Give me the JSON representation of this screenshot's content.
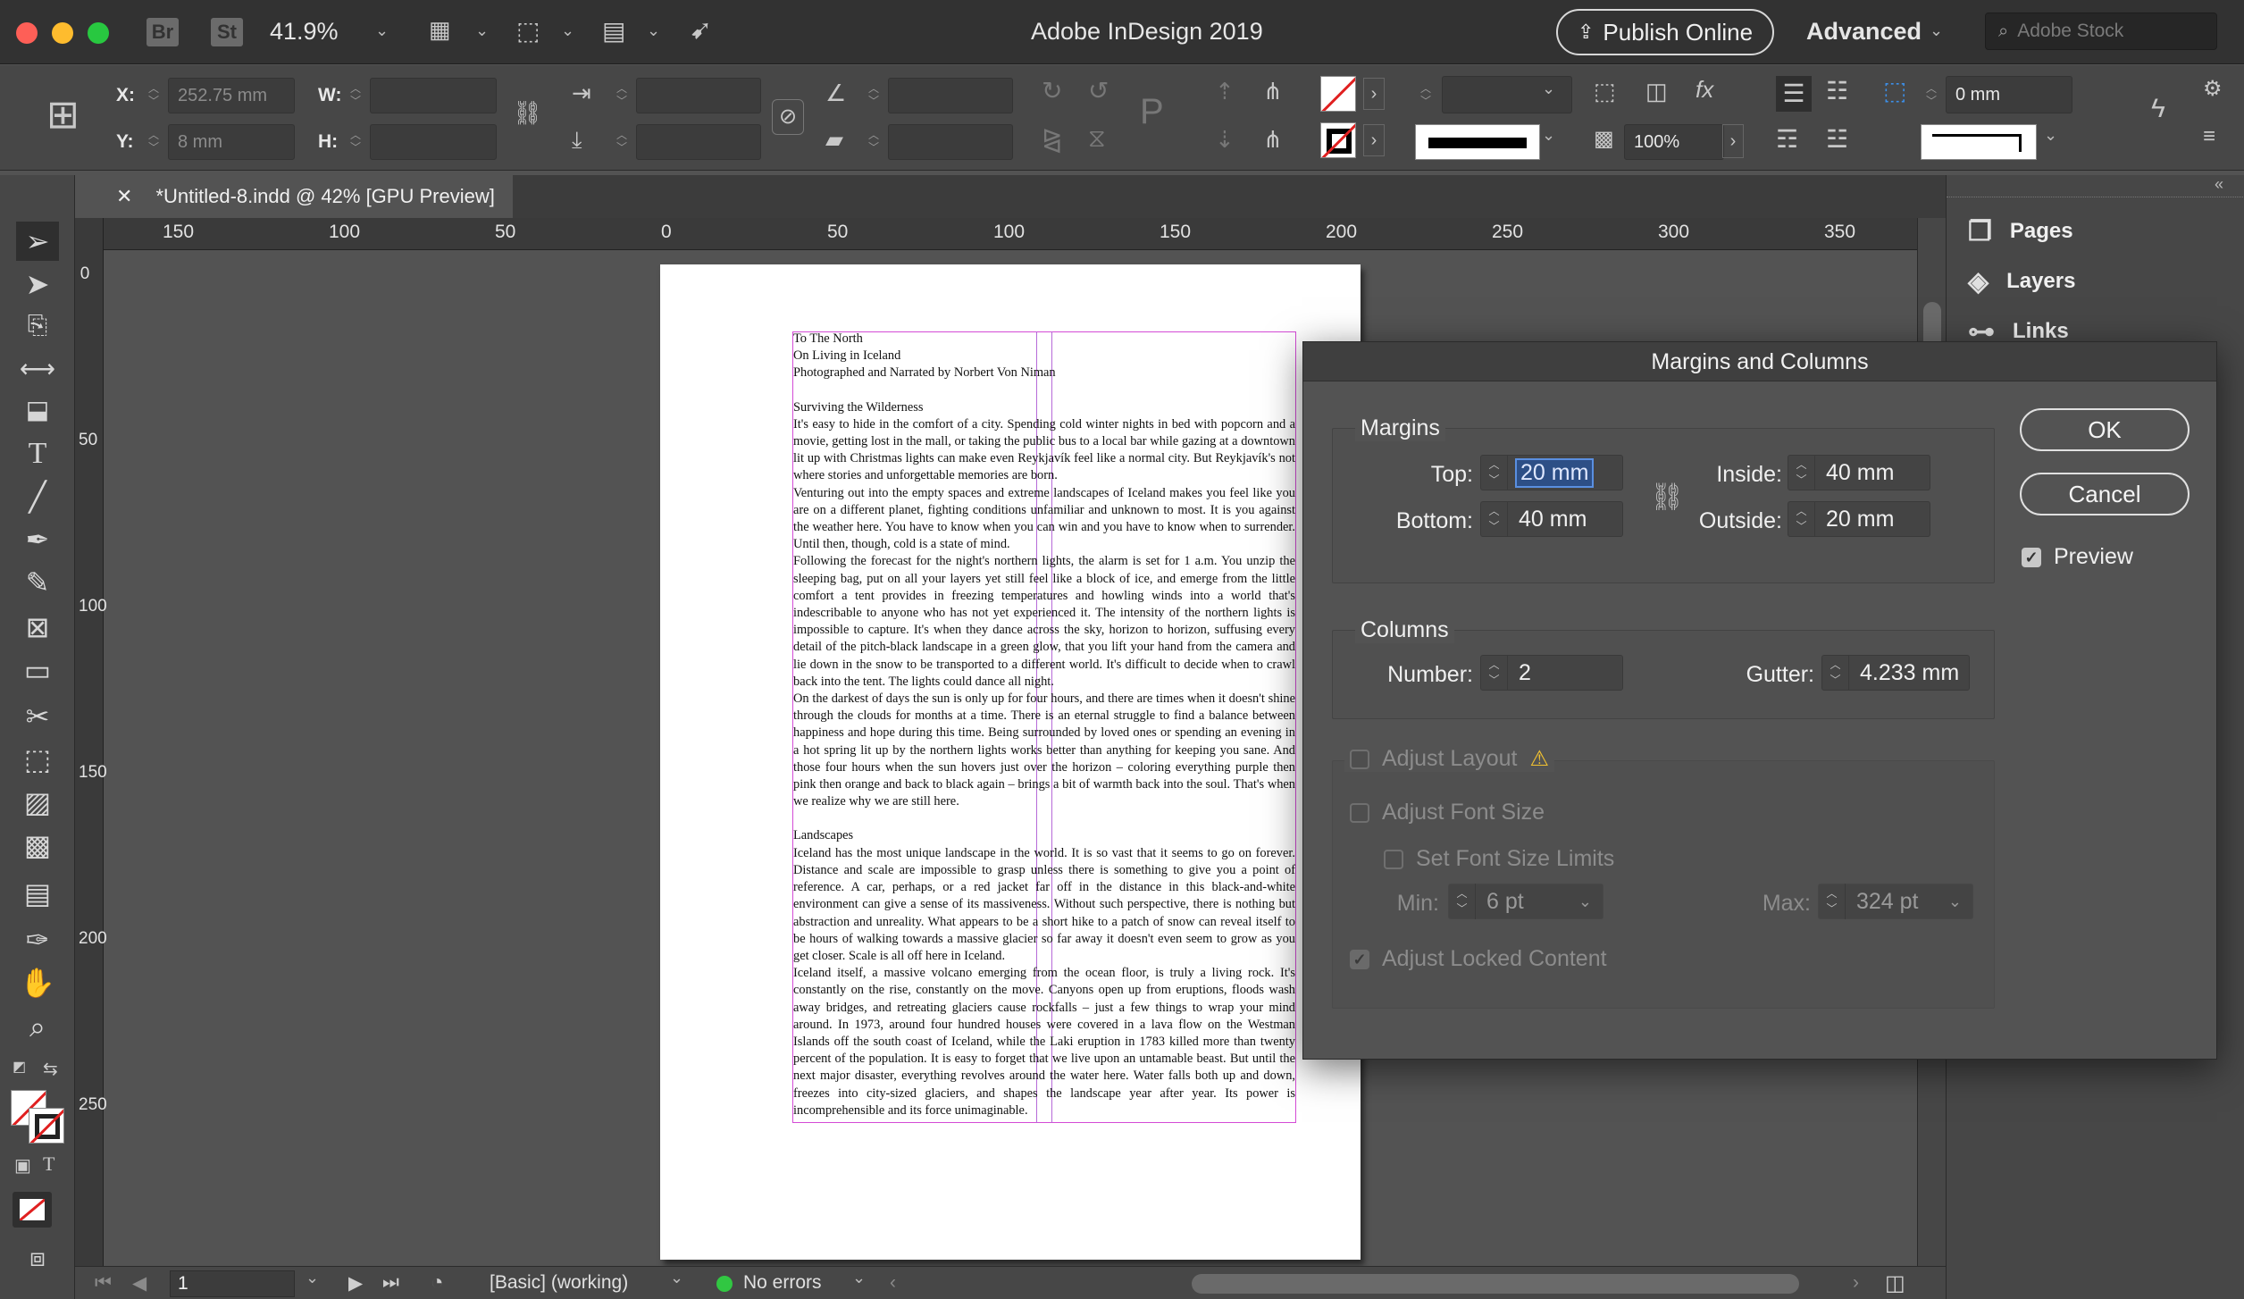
{
  "app": {
    "title": "Adobe InDesign 2019",
    "zoom": "41.9%",
    "bridge_badge": "Br",
    "stock_badge": "St",
    "publish_online": "Publish Online",
    "workspace": "Advanced",
    "search_placeholder": "Adobe Stock"
  },
  "control": {
    "x_label": "X:",
    "x_value": "252.75 mm",
    "y_label": "Y:",
    "y_value": "8 mm",
    "w_label": "W:",
    "w_value": "",
    "h_label": "H:",
    "h_value": "",
    "opacity_value": "100%",
    "offset_value": "0 mm"
  },
  "document_tab": {
    "title": "*Untitled-8.indd @ 42% [GPU Preview]"
  },
  "ruler": {
    "h_ticks": [
      "150",
      "100",
      "50",
      "0",
      "50",
      "100",
      "150",
      "200",
      "250",
      "300",
      "350"
    ],
    "v_ticks": [
      "0",
      "50",
      "100",
      "150",
      "200",
      "250"
    ]
  },
  "document": {
    "paragraphs": [
      "To The North",
      "On Living in Iceland",
      "Photographed and Narrated by Norbert Von Niman",
      "",
      "Surviving the Wilderness",
      "It's easy to hide in the comfort of a city. Spending cold winter nights in bed with popcorn and a movie, getting lost in the mall, or taking the public bus to a local bar while gazing at a downtown lit up with Christmas lights can make even Reykjavík feel like a normal city. But Reykjavík's not where stories and unforgettable memories are born.",
      "Venturing out into the empty spaces and extreme landscapes of Iceland makes you feel like you are on a different planet, fighting conditions unfamiliar and unknown to most. It is you against the weather here. You have to know when you can win and you have to know when to surrender. Until then, though, cold is a state of mind.",
      "Following the forecast for the night's northern lights, the alarm is set for 1 a.m. You unzip the sleeping bag, put on all your layers yet still feel like a block of ice, and emerge from the little comfort a tent provides in freezing temperatures and howling winds into a world that's indescribable to anyone who has not yet experienced it. The intensity of the northern lights is impossible to capture. It's when they dance across the sky, horizon to horizon, suffusing every detail of the pitch-black landscape in a green glow, that you lift your hand from the camera and lie down in the snow to be transported to a different world. It's difficult to decide when to crawl back into the tent. The lights could dance all night.",
      "On the darkest of days the sun is only up for four hours, and there are times when it doesn't shine through the clouds for months at a time. There is an eternal struggle to find a balance between happiness and hope during this time. Being surrounded by loved ones or spending an evening in a hot spring lit up by the northern lights works better than anything for keeping you sane. And those four hours when the sun hovers just over the horizon – coloring everything purple then pink then orange and back to black again – brings a bit of warmth back into the soul. That's when we realize why we are still here.",
      "",
      "Landscapes",
      "Iceland has the most unique landscape in the world. It is so vast that it seems to go on forever. Distance and scale are impossible to grasp unless there is something to give you a point of reference. A car, perhaps, or a red jacket far off in the distance in this black-and-white environment can give a sense of its massiveness. Without such perspective, there is nothing but abstraction and unreality. What appears to be a short hike to a patch of snow can reveal itself to be hours of walking towards a massive glacier so far away it doesn't even seem to grow as you get closer. Scale is all off here in Iceland.",
      "Iceland itself, a massive volcano emerging from the ocean floor, is truly a living rock. It's constantly on the rise, constantly on the move. Canyons open up from eruptions, floods wash away bridges, and retreating glaciers cause rockfalls – just a few things to wrap your mind around. In 1973, around four hundred houses were covered in a lava flow on the Westman Islands off the south coast of Iceland, while the Laki eruption in 1783 killed more than twenty percent of the population. It is easy to forget that we live upon an untamable beast. But until the next major disaster, everything revolves around the water here. Water falls both up and down, freezes into city-sized glaciers, and shapes the landscape year after year. Its power is incomprehensible and its force unimaginable."
    ]
  },
  "panels": {
    "pages": "Pages",
    "layers": "Layers",
    "links": "Links"
  },
  "status": {
    "page_number": "1",
    "style": "[Basic] (working)",
    "errors": "No errors"
  },
  "dialog": {
    "title": "Margins and Columns",
    "margins_title": "Margins",
    "top_label": "Top:",
    "top_value": "20 mm",
    "bottom_label": "Bottom:",
    "bottom_value": "40 mm",
    "inside_label": "Inside:",
    "inside_value": "40 mm",
    "outside_label": "Outside:",
    "outside_value": "20 mm",
    "columns_title": "Columns",
    "number_label": "Number:",
    "number_value": "2",
    "gutter_label": "Gutter:",
    "gutter_value": "4.233 mm",
    "adjust_layout": "Adjust Layout",
    "adjust_font_size": "Adjust Font Size",
    "set_font_size_limits": "Set Font Size Limits",
    "min_label": "Min:",
    "min_value": "6 pt",
    "max_label": "Max:",
    "max_value": "324 pt",
    "adjust_locked_content": "Adjust Locked Content",
    "ok": "OK",
    "cancel": "Cancel",
    "preview": "Preview",
    "preview_checked": true
  }
}
